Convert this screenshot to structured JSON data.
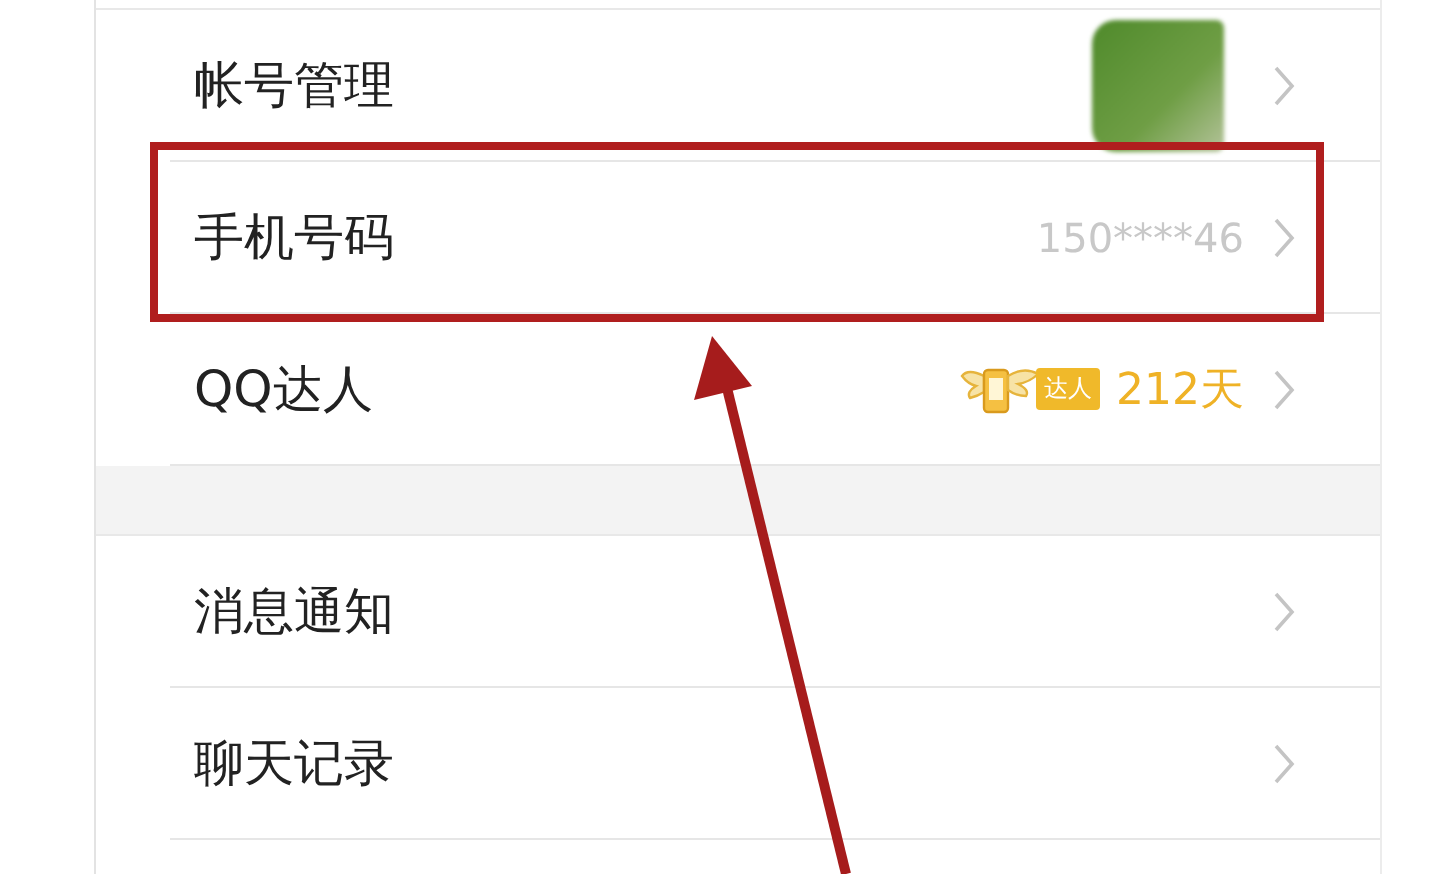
{
  "sections": [
    {
      "rows": [
        {
          "kind": "avatar",
          "label": "帐号管理",
          "highlighted": false
        },
        {
          "kind": "text",
          "label": "手机号码",
          "value": "150****46",
          "highlighted": true
        },
        {
          "kind": "badge",
          "label": "QQ达人",
          "badge": "达人",
          "value": "212天",
          "highlighted": false
        }
      ]
    },
    {
      "rows": [
        {
          "kind": "plain",
          "label": "消息通知",
          "highlighted": false
        },
        {
          "kind": "plain",
          "label": "聊天记录",
          "highlighted": false
        }
      ]
    }
  ]
}
